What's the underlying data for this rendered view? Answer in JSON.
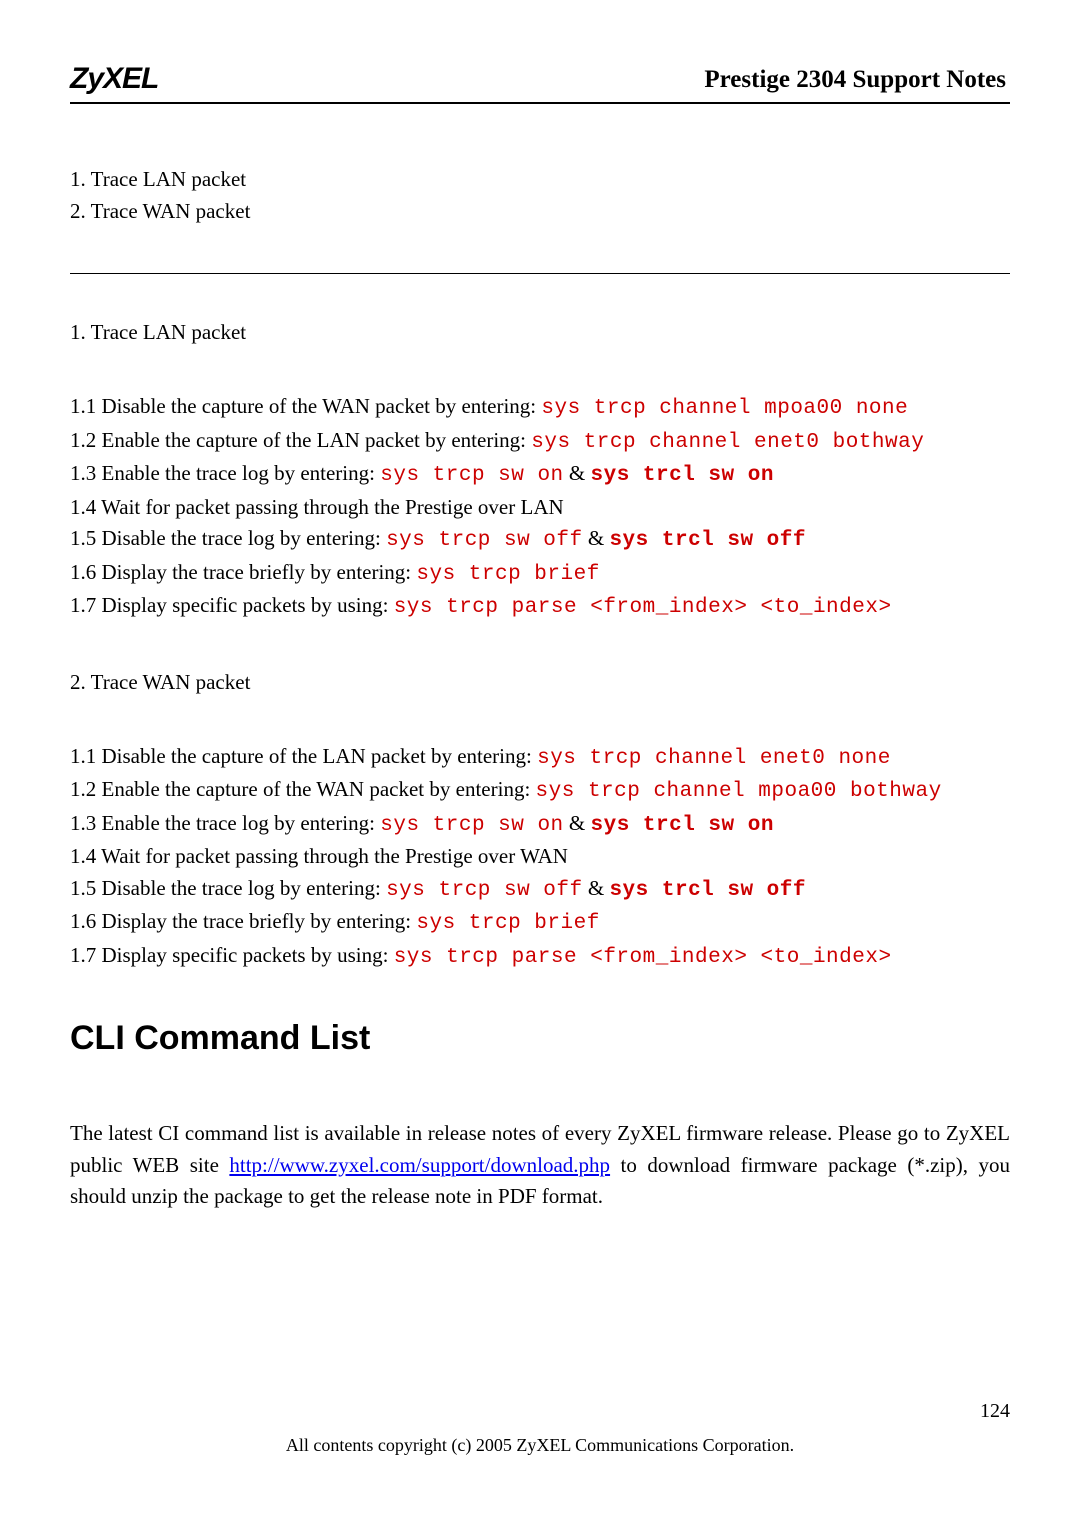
{
  "header": {
    "logo": "ZyXEL",
    "doc_title": "Prestige 2304 Support Notes"
  },
  "top_list": {
    "item1": "1. Trace LAN packet",
    "item2": "2. Trace WAN packet"
  },
  "section1": {
    "title": "1. Trace LAN packet",
    "s1_pre": "1.1 Disable the capture of the WAN packet by entering: ",
    "s1_cmd": "sys trcp channel mpoa00 none",
    "s2_pre": "1.2 Enable the capture of the LAN packet by entering: ",
    "s2_cmd": "sys trcp channel enet0 bothway",
    "s3_pre": "1.3 Enable the trace log by entering: ",
    "s3_cmd1": "sys trcp sw on",
    "s3_mid": " & ",
    "s3_cmd2": "sys trcl sw on",
    "s4": "1.4 Wait for packet passing through the Prestige over LAN",
    "s5_pre": "1.5 Disable the trace log by entering: ",
    "s5_cmd1": "sys trcp sw off",
    "s5_mid": " & ",
    "s5_cmd2": "sys trcl sw off",
    "s6_pre": "1.6 Display the trace briefly by entering: ",
    "s6_cmd": "sys trcp brief",
    "s7_pre": "1.7 Display specific packets by using: ",
    "s7_cmd": "sys trcp parse <from_index> <to_index>"
  },
  "section2": {
    "title": "2. Trace WAN packet",
    "s1_pre": "1.1 Disable the capture of the LAN packet by entering: ",
    "s1_cmd": "sys trcp channel enet0 none",
    "s2_pre": "1.2 Enable the capture of the WAN packet by entering: ",
    "s2_cmd": "sys trcp channel mpoa00 bothway",
    "s3_pre": "1.3 Enable the trace log by entering: ",
    "s3_cmd1": "sys trcp sw on",
    "s3_mid": " & ",
    "s3_cmd2": "sys trcl sw on",
    "s4": "1.4 Wait for packet passing through the Prestige over WAN",
    "s5_pre": "1.5 Disable the trace log by entering: ",
    "s5_cmd1": "sys trcp sw off",
    "s5_mid": " & ",
    "s5_cmd2": "sys trcl sw off",
    "s6_pre": "1.6 Display the trace briefly by entering: ",
    "s6_cmd": "sys trcp brief",
    "s7_pre": "1.7 Display specific packets by using: ",
    "s7_cmd": "sys trcp parse <from_index> <to_index>"
  },
  "heading2": "CLI Command List",
  "paragraph": {
    "p1": "The latest CI command list is available in release notes of every ZyXEL firmware release. Please go to ZyXEL public WEB site   ",
    "link_text": "http://www.zyxel.com/support/download.php",
    "p2": " to download firmware package (*.zip), you should unzip the package to get the release note in PDF format."
  },
  "page_number": "124",
  "footer": "All contents copyright (c) 2005 ZyXEL Communications Corporation."
}
